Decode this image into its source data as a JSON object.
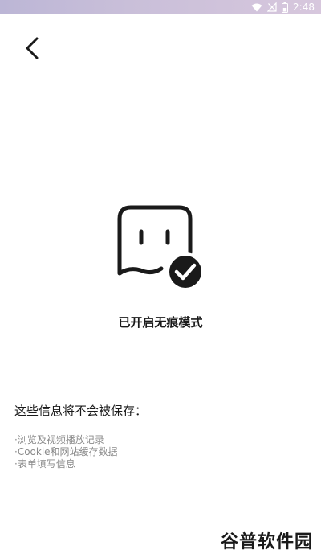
{
  "status_bar": {
    "time": "2:48",
    "icons": [
      "wifi-icon",
      "signal-off-icon",
      "battery-icon"
    ]
  },
  "nav": {
    "back_icon": "chevron-left-icon"
  },
  "incognito": {
    "icon": "ghost-check-icon",
    "title": "已开启无痕模式"
  },
  "info": {
    "heading": "这些信息将不会被保存：",
    "items": [
      "·浏览及视频播放记录",
      "·Cookie和网站缓存数据",
      "·表单填写信息"
    ]
  },
  "watermark": {
    "text": "谷普软件园"
  }
}
